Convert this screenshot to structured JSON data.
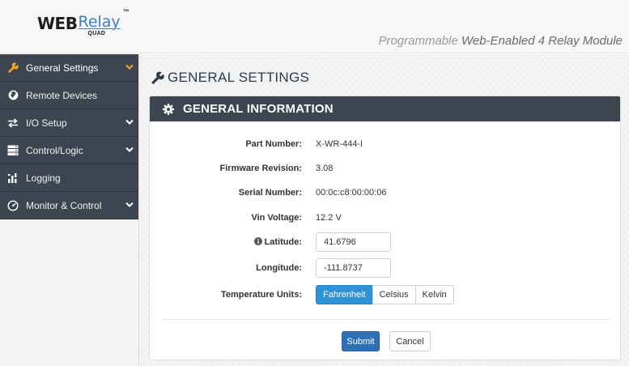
{
  "header": {
    "logo_web": "WEB",
    "logo_relay": "Relay",
    "logo_tm": "™",
    "logo_quad": "QUAD",
    "tagline_prefix": "Programmable ",
    "tagline_bold": "Web-Enabled 4 Relay Module"
  },
  "sidebar": {
    "items": [
      {
        "label": "General Settings",
        "icon": "wrench-icon",
        "chevron": true,
        "active": true
      },
      {
        "label": "Remote Devices",
        "icon": "globe-icon",
        "chevron": false,
        "active": false
      },
      {
        "label": "I/O Setup",
        "icon": "exchange-icon",
        "chevron": true,
        "active": false
      },
      {
        "label": "Control/Logic",
        "icon": "server-icon",
        "chevron": true,
        "active": false
      },
      {
        "label": "Logging",
        "icon": "bar-chart-icon",
        "chevron": false,
        "active": false
      },
      {
        "label": "Monitor & Control",
        "icon": "dashboard-icon",
        "chevron": true,
        "active": false
      }
    ]
  },
  "main": {
    "page_title": "GENERAL SETTINGS",
    "panel_title": "GENERAL INFORMATION",
    "fields": {
      "part_number": {
        "label": "Part Number:",
        "value": "X-WR-444-I"
      },
      "firmware": {
        "label": "Firmware Revision:",
        "value": "3.08"
      },
      "serial": {
        "label": "Serial Number:",
        "value": "00:0c:c8:00:00:06"
      },
      "vin": {
        "label": "Vin Voltage:",
        "value": "12.2 V"
      },
      "latitude": {
        "label": "Latitude:",
        "value": "41.6796"
      },
      "longitude": {
        "label": "Longitude:",
        "value": "-111.8737"
      },
      "temp_units": {
        "label": "Temperature Units:",
        "options": [
          "Fahrenheit",
          "Celsius",
          "Kelvin"
        ],
        "selected": "Fahrenheit"
      }
    },
    "submit_label": "Submit",
    "cancel_label": "Cancel"
  },
  "colors": {
    "nav_bg": "#3d4650",
    "panel_header_bg": "#3d4650",
    "accent_blue": "#2f92d6",
    "submit_blue": "#2f6fb5",
    "logo_blue": "#3a7fc4"
  }
}
